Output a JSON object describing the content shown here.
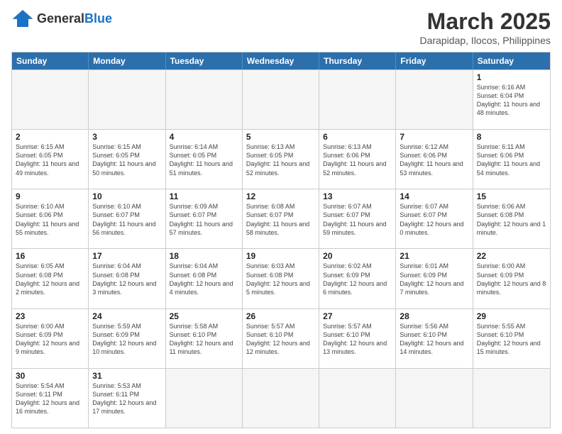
{
  "header": {
    "logo_general": "General",
    "logo_blue": "Blue",
    "title": "March 2025",
    "subtitle": "Darapidap, Ilocos, Philippines"
  },
  "weekdays": [
    "Sunday",
    "Monday",
    "Tuesday",
    "Wednesday",
    "Thursday",
    "Friday",
    "Saturday"
  ],
  "rows": [
    [
      {
        "day": "",
        "info": ""
      },
      {
        "day": "",
        "info": ""
      },
      {
        "day": "",
        "info": ""
      },
      {
        "day": "",
        "info": ""
      },
      {
        "day": "",
        "info": ""
      },
      {
        "day": "",
        "info": ""
      },
      {
        "day": "1",
        "info": "Sunrise: 6:16 AM\nSunset: 6:04 PM\nDaylight: 11 hours and 48 minutes."
      }
    ],
    [
      {
        "day": "2",
        "info": "Sunrise: 6:15 AM\nSunset: 6:05 PM\nDaylight: 11 hours and 49 minutes."
      },
      {
        "day": "3",
        "info": "Sunrise: 6:15 AM\nSunset: 6:05 PM\nDaylight: 11 hours and 50 minutes."
      },
      {
        "day": "4",
        "info": "Sunrise: 6:14 AM\nSunset: 6:05 PM\nDaylight: 11 hours and 51 minutes."
      },
      {
        "day": "5",
        "info": "Sunrise: 6:13 AM\nSunset: 6:05 PM\nDaylight: 11 hours and 52 minutes."
      },
      {
        "day": "6",
        "info": "Sunrise: 6:13 AM\nSunset: 6:06 PM\nDaylight: 11 hours and 52 minutes."
      },
      {
        "day": "7",
        "info": "Sunrise: 6:12 AM\nSunset: 6:06 PM\nDaylight: 11 hours and 53 minutes."
      },
      {
        "day": "8",
        "info": "Sunrise: 6:11 AM\nSunset: 6:06 PM\nDaylight: 11 hours and 54 minutes."
      }
    ],
    [
      {
        "day": "9",
        "info": "Sunrise: 6:10 AM\nSunset: 6:06 PM\nDaylight: 11 hours and 55 minutes."
      },
      {
        "day": "10",
        "info": "Sunrise: 6:10 AM\nSunset: 6:07 PM\nDaylight: 11 hours and 56 minutes."
      },
      {
        "day": "11",
        "info": "Sunrise: 6:09 AM\nSunset: 6:07 PM\nDaylight: 11 hours and 57 minutes."
      },
      {
        "day": "12",
        "info": "Sunrise: 6:08 AM\nSunset: 6:07 PM\nDaylight: 11 hours and 58 minutes."
      },
      {
        "day": "13",
        "info": "Sunrise: 6:07 AM\nSunset: 6:07 PM\nDaylight: 11 hours and 59 minutes."
      },
      {
        "day": "14",
        "info": "Sunrise: 6:07 AM\nSunset: 6:07 PM\nDaylight: 12 hours and 0 minutes."
      },
      {
        "day": "15",
        "info": "Sunrise: 6:06 AM\nSunset: 6:08 PM\nDaylight: 12 hours and 1 minute."
      }
    ],
    [
      {
        "day": "16",
        "info": "Sunrise: 6:05 AM\nSunset: 6:08 PM\nDaylight: 12 hours and 2 minutes."
      },
      {
        "day": "17",
        "info": "Sunrise: 6:04 AM\nSunset: 6:08 PM\nDaylight: 12 hours and 3 minutes."
      },
      {
        "day": "18",
        "info": "Sunrise: 6:04 AM\nSunset: 6:08 PM\nDaylight: 12 hours and 4 minutes."
      },
      {
        "day": "19",
        "info": "Sunrise: 6:03 AM\nSunset: 6:08 PM\nDaylight: 12 hours and 5 minutes."
      },
      {
        "day": "20",
        "info": "Sunrise: 6:02 AM\nSunset: 6:09 PM\nDaylight: 12 hours and 6 minutes."
      },
      {
        "day": "21",
        "info": "Sunrise: 6:01 AM\nSunset: 6:09 PM\nDaylight: 12 hours and 7 minutes."
      },
      {
        "day": "22",
        "info": "Sunrise: 6:00 AM\nSunset: 6:09 PM\nDaylight: 12 hours and 8 minutes."
      }
    ],
    [
      {
        "day": "23",
        "info": "Sunrise: 6:00 AM\nSunset: 6:09 PM\nDaylight: 12 hours and 9 minutes."
      },
      {
        "day": "24",
        "info": "Sunrise: 5:59 AM\nSunset: 6:09 PM\nDaylight: 12 hours and 10 minutes."
      },
      {
        "day": "25",
        "info": "Sunrise: 5:58 AM\nSunset: 6:10 PM\nDaylight: 12 hours and 11 minutes."
      },
      {
        "day": "26",
        "info": "Sunrise: 5:57 AM\nSunset: 6:10 PM\nDaylight: 12 hours and 12 minutes."
      },
      {
        "day": "27",
        "info": "Sunrise: 5:57 AM\nSunset: 6:10 PM\nDaylight: 12 hours and 13 minutes."
      },
      {
        "day": "28",
        "info": "Sunrise: 5:56 AM\nSunset: 6:10 PM\nDaylight: 12 hours and 14 minutes."
      },
      {
        "day": "29",
        "info": "Sunrise: 5:55 AM\nSunset: 6:10 PM\nDaylight: 12 hours and 15 minutes."
      }
    ],
    [
      {
        "day": "30",
        "info": "Sunrise: 5:54 AM\nSunset: 6:11 PM\nDaylight: 12 hours and 16 minutes."
      },
      {
        "day": "31",
        "info": "Sunrise: 5:53 AM\nSunset: 6:11 PM\nDaylight: 12 hours and 17 minutes."
      },
      {
        "day": "",
        "info": ""
      },
      {
        "day": "",
        "info": ""
      },
      {
        "day": "",
        "info": ""
      },
      {
        "day": "",
        "info": ""
      },
      {
        "day": "",
        "info": ""
      }
    ]
  ]
}
